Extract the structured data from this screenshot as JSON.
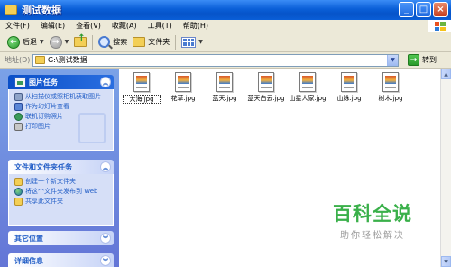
{
  "window": {
    "title": "测试数据"
  },
  "menubar": {
    "items": [
      "文件(F)",
      "编辑(E)",
      "查看(V)",
      "收藏(A)",
      "工具(T)",
      "帮助(H)"
    ]
  },
  "toolbar": {
    "back_label": "后退",
    "search_label": "搜索",
    "folders_label": "文件夹"
  },
  "address": {
    "label": "地址(D)",
    "value": "G:\\测试数据",
    "go_label": "转到"
  },
  "taskpane": {
    "picture_tasks": {
      "title": "图片任务",
      "items": [
        "从扫描仪或照相机获取图片",
        "作为幻灯片查看",
        "联机订购照片",
        "打印图片"
      ]
    },
    "file_tasks": {
      "title": "文件和文件夹任务",
      "items": [
        "创建一个新文件夹",
        "将这个文件夹发布到 Web",
        "共享此文件夹"
      ]
    },
    "other_places": {
      "title": "其它位置"
    },
    "details": {
      "title": "详细信息"
    }
  },
  "files": [
    {
      "name": "大海.jpg",
      "selected": true
    },
    {
      "name": "花草.jpg",
      "selected": false
    },
    {
      "name": "蓝天.jpg",
      "selected": false
    },
    {
      "name": "蓝天白云.jpg",
      "selected": false
    },
    {
      "name": "山星人家.jpg",
      "selected": false
    },
    {
      "name": "山脉.jpg",
      "selected": false
    },
    {
      "name": "树木.jpg",
      "selected": false
    }
  ],
  "watermark": {
    "title": "百科全说",
    "subtitle": "助你轻松解决"
  },
  "colors": {
    "titlebar": "#0a5fd8",
    "taskpane": "#7ba2e7",
    "link": "#215dc6",
    "watermark": "#3ab04a"
  }
}
